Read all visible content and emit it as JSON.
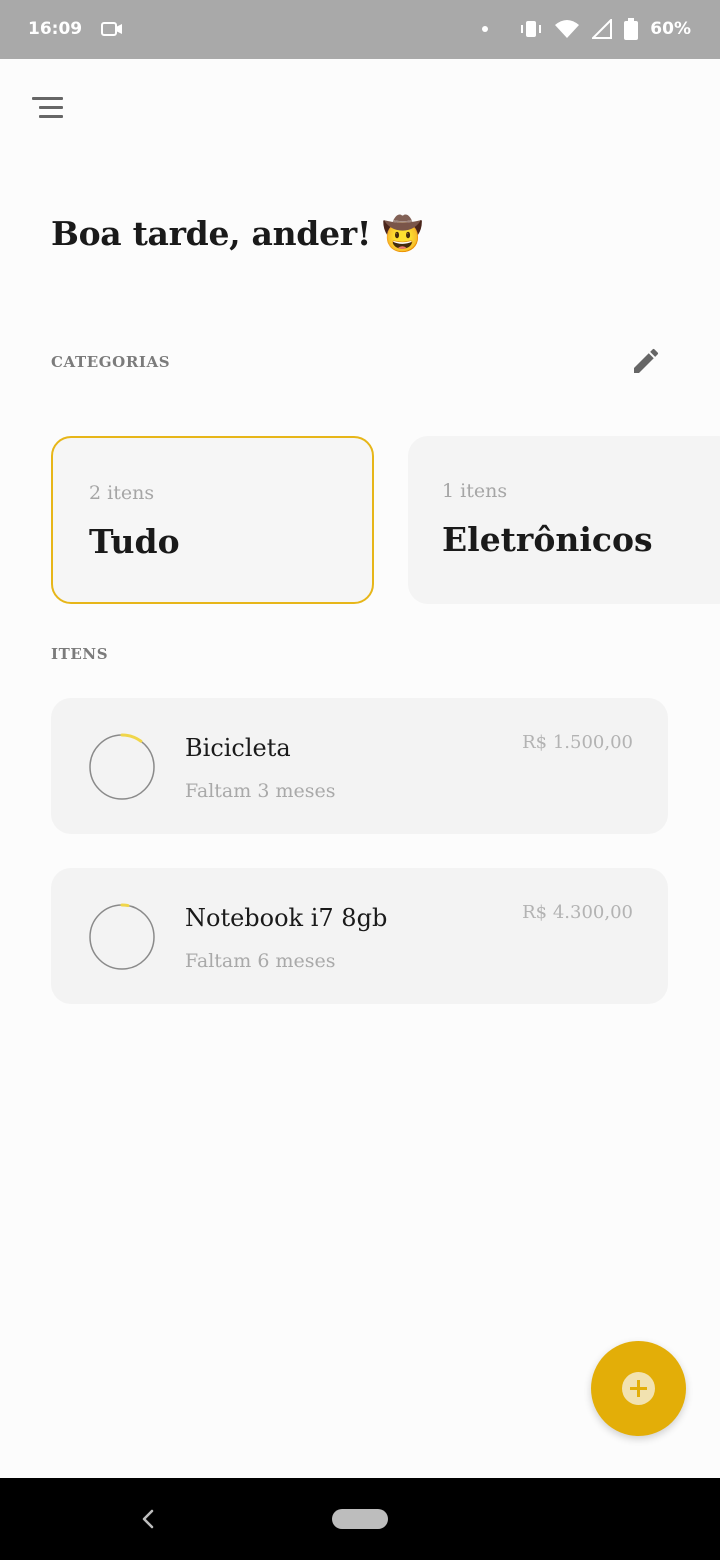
{
  "status_bar": {
    "time": "16:09",
    "battery": "60%",
    "icons": [
      "video-camera-icon",
      "dot-icon",
      "vibrate-icon",
      "wifi-icon",
      "cellular-signal-icon",
      "battery-icon"
    ]
  },
  "header": {
    "menu_icon": "menu-icon",
    "greeting": "Boa tarde, ander! 🤠"
  },
  "categories": {
    "label": "CATEGORIAS",
    "edit_icon": "pencil-icon",
    "cards": [
      {
        "count": "2 itens",
        "name": "Tudo",
        "selected": true
      },
      {
        "count": "1 itens",
        "name": "Eletrônicos",
        "selected": false
      }
    ]
  },
  "items": {
    "label": "ITENS",
    "list": [
      {
        "title": "Bicicleta",
        "subtitle": "Faltam 3 meses",
        "price": "R$ 1.500,00",
        "progress": 0.1
      },
      {
        "title": "Notebook i7 8gb",
        "subtitle": "Faltam 6 meses",
        "price": "R$ 4.300,00",
        "progress": 0.03
      }
    ]
  },
  "fab": {
    "icon": "add-icon"
  },
  "navigation_bar": {
    "back_icon": "back-icon",
    "home_icon": "home-pill-icon"
  },
  "colors": {
    "accent": "#e3ae08",
    "card_border_selected": "#e7b619",
    "background": "#fcfcfc",
    "status_bar": "#a9a9a9",
    "progress_ring": "#8a8a8a",
    "progress_fill": "#f0d64a"
  }
}
